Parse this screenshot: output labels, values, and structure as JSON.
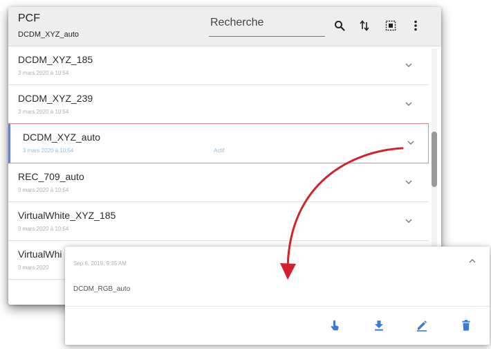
{
  "header": {
    "title": "PCF",
    "subtitle": "DCDM_XYZ_auto",
    "search_placeholder": "Recherche"
  },
  "toolbar_icons": [
    "search-icon",
    "sort-icon",
    "select-all-icon",
    "more-vert-icon"
  ],
  "list": {
    "items": [
      {
        "name": "DCDM_XYZ_185",
        "date": "3 mars 2020 à 10:54",
        "active": false
      },
      {
        "name": "DCDM_XYZ_239",
        "date": "3 mars 2020 à 10:54",
        "active": false
      },
      {
        "name": "DCDM_XYZ_auto",
        "date": "3 mars 2020 à 10:54",
        "status": "Actif",
        "active": true
      },
      {
        "name": "REC_709_auto",
        "date": "3 mars 2020 à 10:54",
        "active": false
      },
      {
        "name": "VirtualWhite_XYZ_185",
        "date": "3 mars 2020 à 10:54",
        "active": false
      },
      {
        "name": "VirtualWhi",
        "date": "3 mars 2020",
        "active": false
      }
    ]
  },
  "popup": {
    "date": "Sep 6, 2019, 9:35 AM",
    "name": "DCDM_RGB_auto",
    "action_icons": [
      "touch-icon",
      "download-icon",
      "edit-icon",
      "delete-icon"
    ]
  },
  "colors": {
    "accent_blue": "#3b7ad9",
    "active_border": "#e28a8a",
    "active_left_bar": "#6c7fd6",
    "active_text": "#8ec1ea",
    "arrow": "#d4202a"
  }
}
